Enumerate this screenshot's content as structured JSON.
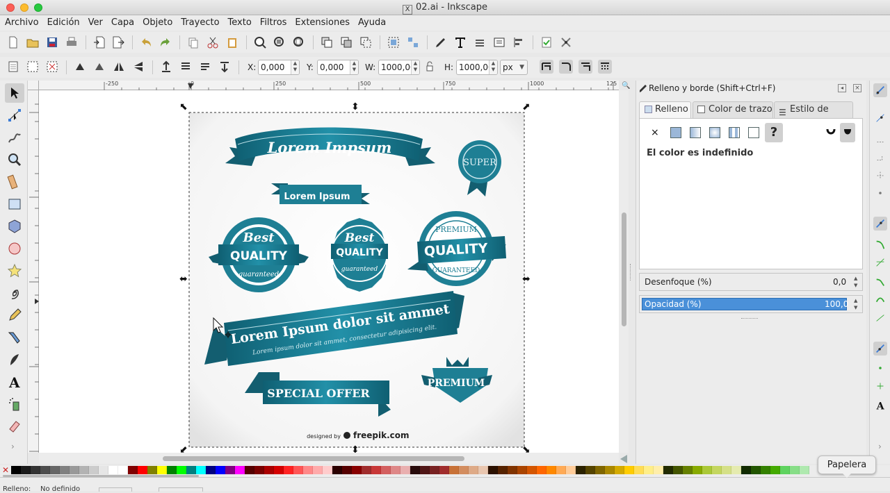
{
  "window": {
    "title": "02.ai - Inkscape"
  },
  "menubar": {
    "items": [
      "Archivo",
      "Edición",
      "Ver",
      "Capa",
      "Objeto",
      "Trayecto",
      "Texto",
      "Filtros",
      "Extensiones",
      "Ayuda"
    ]
  },
  "toolbar2": {
    "x_label": "X:",
    "x_value": "0,000",
    "y_label": "Y:",
    "y_value": "0,000",
    "w_label": "W:",
    "w_value": "1000,00",
    "h_label": "H:",
    "h_value": "1000,00",
    "unit": "px"
  },
  "ruler": {
    "ticks": [
      "-250",
      "0",
      "250",
      "500",
      "750",
      "1000",
      "125"
    ]
  },
  "artwork": {
    "ribbon_top": "Lorem Impsum",
    "ribbon_small": "Lorem Ipsum",
    "seal_small": "SUPER",
    "badge1": {
      "top": "Best",
      "main": "QUALITY",
      "bottom": "guaranteed"
    },
    "badge2": {
      "top": "Best",
      "main": "QUALITY",
      "bottom": "guaranteed"
    },
    "badge3": {
      "top": "PREMIUM",
      "main": "QUALITY",
      "bottom": "GUARANTEED"
    },
    "banner_main": "Lorem Ipsum dolor sit ammet",
    "banner_sub": "Lorem ipsum dolor sit ammet, consectetur adipisicing elit.",
    "special": "SPECIAL OFFER",
    "premium": "PREMIUM",
    "credit_prefix": "designed by",
    "credit": "freepik.com"
  },
  "dock": {
    "title": "Relleno y borde (Shift+Ctrl+F)",
    "tabs": [
      "Relleno",
      "Color de trazo",
      "Estilo de trazo"
    ],
    "fill_message": "El color es indefinido",
    "blur_label": "Desenfoque (%)",
    "blur_value": "0,0",
    "opacity_label": "Opacidad (%)",
    "opacity_value": "100,0",
    "opacity_percent": 100
  },
  "tooltip": "Papelera",
  "status": {
    "fill_label": "Relleno:",
    "fill_value": "No definido"
  },
  "colors": {
    "accent": "#1e7f94",
    "selection": "#4a90d9"
  }
}
